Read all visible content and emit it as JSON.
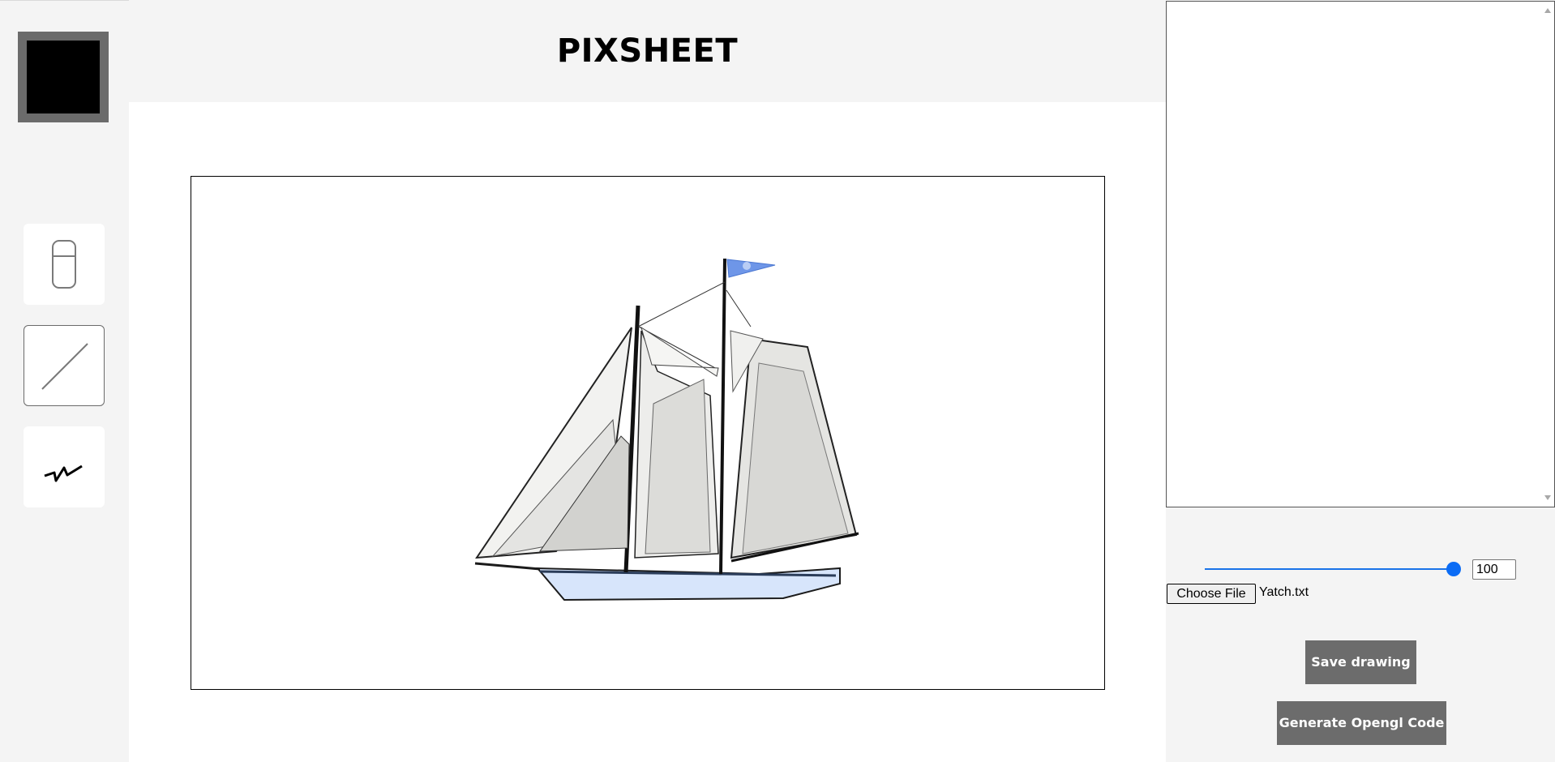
{
  "app": {
    "title": "PIXSHEET"
  },
  "toolbar": {
    "current_color": "#000000",
    "tools": [
      {
        "name": "eraser",
        "icon": "eraser-icon"
      },
      {
        "name": "line",
        "icon": "line-icon",
        "active": true
      },
      {
        "name": "polyline",
        "icon": "polyline-icon"
      }
    ]
  },
  "canvas": {
    "content": "sailboat-drawing"
  },
  "code_panel": {
    "value": ""
  },
  "zoom": {
    "value": 100,
    "max": 100
  },
  "file": {
    "button_label": "Choose File",
    "selected_name": "Yatch.txt"
  },
  "actions": {
    "save_label": "Save drawing",
    "generate_label": "Generate Opengl Code"
  },
  "colors": {
    "background": "#f4f4f4",
    "button": "#6c6c6c",
    "slider_accent": "#0b6cf5",
    "swatch_border": "#6b6b6b"
  }
}
